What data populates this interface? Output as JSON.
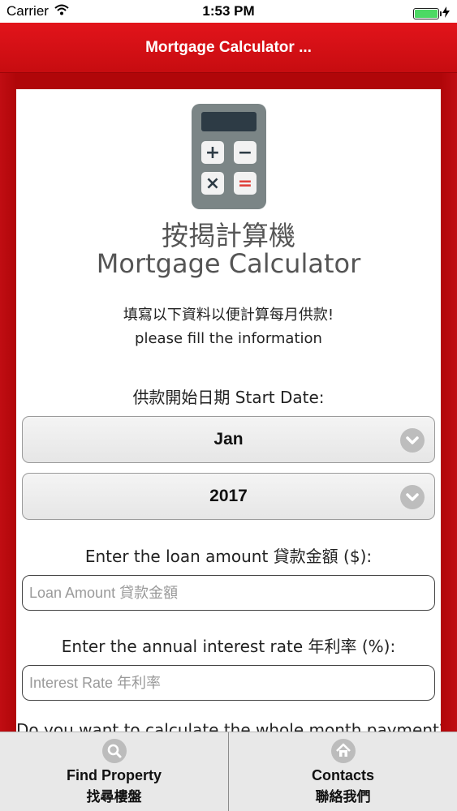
{
  "status_bar": {
    "carrier": "Carrier",
    "time": "1:53 PM",
    "battery_level": 1.0
  },
  "nav": {
    "title": "Mortgage Calculator ..."
  },
  "header": {
    "icon": "calculator-icon",
    "keys": [
      "+",
      "−",
      "×",
      "="
    ],
    "title_cn": "按揭計算機",
    "title_en": "Mortgage Calculator",
    "intro_cn": "填寫以下資料以便計算每月供款!",
    "intro_en": "please fill the information"
  },
  "form": {
    "start_date_label": "供款開始日期 Start Date:",
    "month_value": "Jan",
    "year_value": "2017",
    "loan_label": "Enter the loan amount 貸款金額 ($):",
    "loan_placeholder": "Loan Amount 貸款金額",
    "rate_label": "Enter the annual interest rate 年利率 (%):",
    "rate_placeholder": "Interest Rate 年利率",
    "next_question_partial": "Do you want to calculate the whole month payment?"
  },
  "tabs": [
    {
      "icon": "search-icon",
      "label_en": "Find Property",
      "label_cn": "找尋樓盤"
    },
    {
      "icon": "home-icon",
      "label_en": "Contacts",
      "label_cn": "聯絡我們"
    }
  ],
  "colors": {
    "brand_red": "#d8111a",
    "frame_red": "#b00609",
    "battery_green": "#4cd964"
  }
}
